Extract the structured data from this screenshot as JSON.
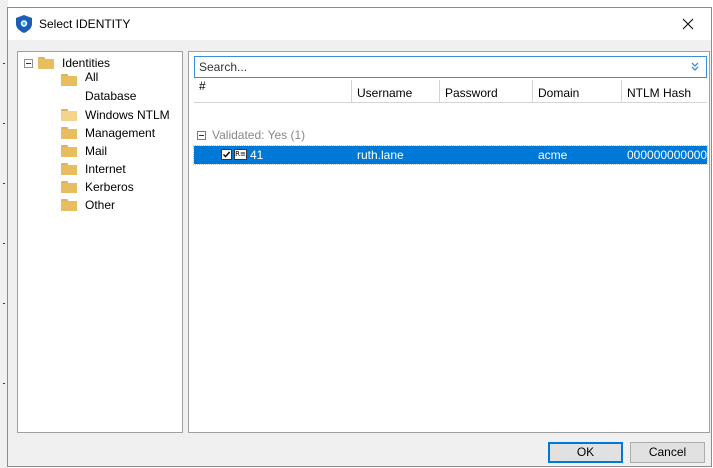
{
  "window": {
    "title": "Select IDENTITY",
    "close_glyph": "✕"
  },
  "tree": {
    "root": {
      "label": "Identities",
      "expanded": true
    },
    "items": [
      {
        "label": "All",
        "selected": false
      },
      {
        "label": "Database",
        "selected": false
      },
      {
        "label": "Windows NTLM",
        "selected": true
      },
      {
        "label": "Management",
        "selected": false
      },
      {
        "label": "Mail",
        "selected": false
      },
      {
        "label": "Internet",
        "selected": false
      },
      {
        "label": "Kerberos",
        "selected": false
      },
      {
        "label": "Other",
        "selected": false
      }
    ]
  },
  "search": {
    "placeholder": "Search...",
    "value": ""
  },
  "grid": {
    "columns": [
      "#",
      "Username",
      "Password",
      "Domain",
      "NTLM Hash"
    ],
    "group": {
      "label": "Validated: Yes (1)"
    },
    "rows": [
      {
        "checked": true,
        "id": "41",
        "username": "ruth.lane",
        "password": "",
        "domain": "acme",
        "ntlm_hash": "000000000000..."
      }
    ]
  },
  "buttons": {
    "ok": "OK",
    "cancel": "Cancel"
  },
  "colors": {
    "selection": "#0078d7",
    "folder": "#e7bd60",
    "accent": "#3b8fd9"
  },
  "icons": {
    "app": "shield-icon",
    "folder": "folder-icon",
    "collapse": "collapse-icon",
    "search_options": "chevron-double-down-icon",
    "identity_card": "identity-card-icon"
  }
}
